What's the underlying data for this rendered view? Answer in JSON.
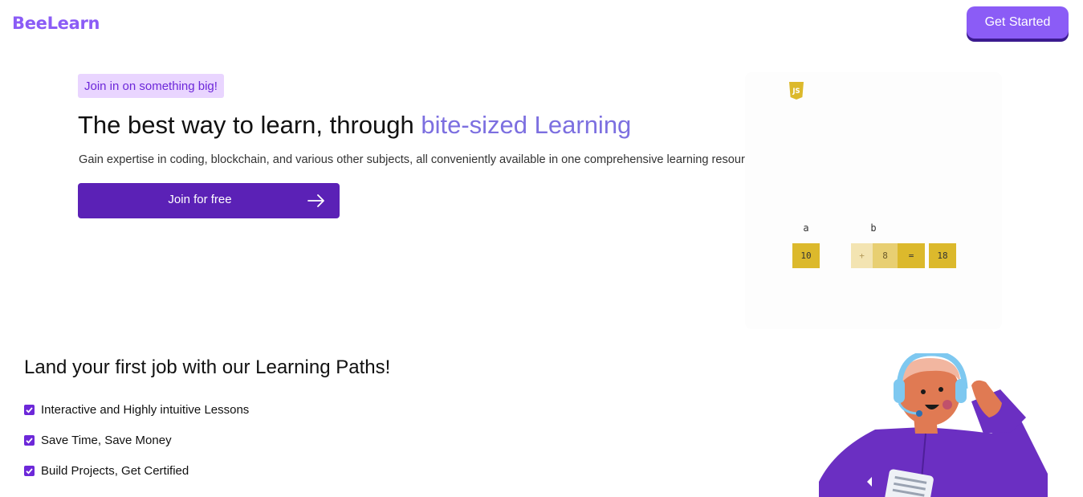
{
  "header": {
    "logo": "BeeLearn",
    "cta_label": "Get Started"
  },
  "hero": {
    "badge": "Join in on something big!",
    "title_plain": "The best way to learn, through ",
    "title_accent": "bite-sized Learning",
    "subtitle": "Gain expertise in coding, blockchain, and various other subjects, all conveniently available in one comprehensive learning resource",
    "join_label": "Join for free",
    "join_icon": "arrow-right-icon"
  },
  "code_visual": {
    "language_icon": "javascript-icon",
    "language_icon_text": "JS",
    "var_a_label": "a",
    "var_b_label": "b",
    "cell_a": "10",
    "cell_plus": "+",
    "cell_b": "8",
    "cell_eq": "=",
    "cell_result": "18",
    "colors": {
      "gold": "#dcb92c",
      "gold_light": "#f3e4b2",
      "gold_mid": "#e8cf72"
    }
  },
  "paths": {
    "title": "Land your first job with our Learning Paths!",
    "features": [
      "Interactive and Highly intuitive Lessons",
      "Save Time, Save Money",
      "Build Projects, Get Certified"
    ]
  },
  "colors": {
    "brand": "#8b5cf6",
    "primary_dark": "#5b21b6",
    "badge_bg": "#e9d5ff",
    "accent_text": "#7c6fe0"
  }
}
